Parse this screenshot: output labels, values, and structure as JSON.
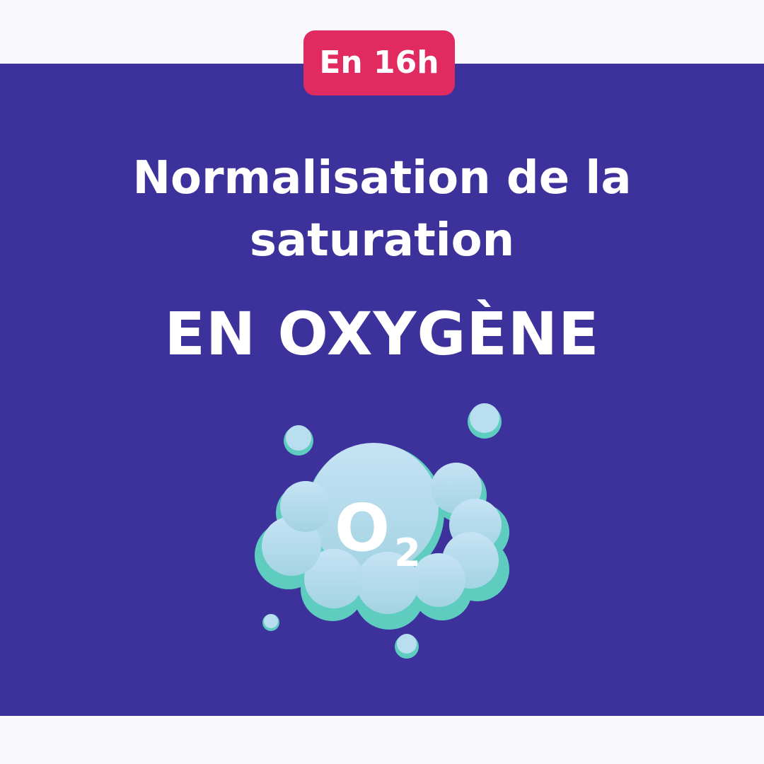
{
  "badge": {
    "label": "En 16h"
  },
  "title": {
    "line1": "Normalisation de la",
    "line2": "saturation"
  },
  "subtitle": "EN OXYGÈNE",
  "illustration": {
    "icon": "oxygen-cloud-icon",
    "formula": "O",
    "subscript": "2"
  },
  "colors": {
    "background": "#f8f8fd",
    "panel": "#3d319c",
    "badge": "#e12a5f",
    "cloud": "#add8e6",
    "cloud_shadow": "#5ecdbf"
  }
}
